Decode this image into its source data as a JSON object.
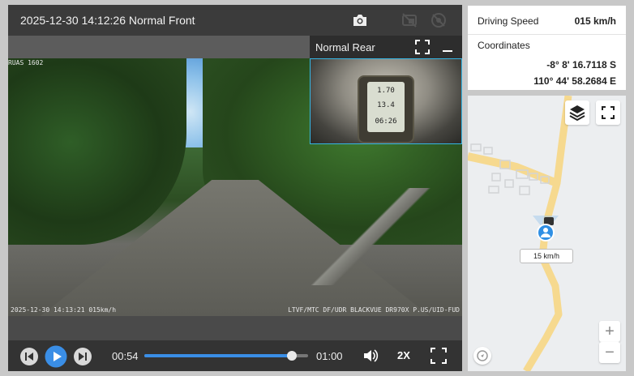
{
  "player": {
    "title": "2025-12-30 14:12:26 Normal Front",
    "pip_label": "Normal Rear",
    "overlay": {
      "top_left": "RUAS 1602",
      "bottom_left": "2025-12-30 14:13:21 015km/h",
      "bottom_right": "LTVF/MTC DF/UDR BLACKVUE DR970X P.US/UID-FUD"
    },
    "gps_readout": [
      "1.70",
      "13.4",
      "06:26"
    ],
    "controls": {
      "current_time": "00:54",
      "total_time": "01:00",
      "progress": 0.9,
      "speed": "2X"
    }
  },
  "info": {
    "speed_label": "Driving Speed",
    "speed_value": "015 km/h",
    "coords_label": "Coordinates",
    "latitude": "-8° 8' 16.7118 S",
    "longitude": "110° 44' 58.2684 E"
  },
  "map": {
    "speed_tag": "15 km/h",
    "zoom_in": "+",
    "zoom_out": "−",
    "road_color": "#f6d98f",
    "marker_color": "#2f8fe4"
  },
  "icons": [
    "camera-icon",
    "pip-off-icon",
    "cc-off-icon",
    "expand-icon",
    "minimize-icon",
    "prev-icon",
    "play-icon",
    "next-icon",
    "volume-icon",
    "fullscreen-icon",
    "layers-icon",
    "compass-icon"
  ]
}
